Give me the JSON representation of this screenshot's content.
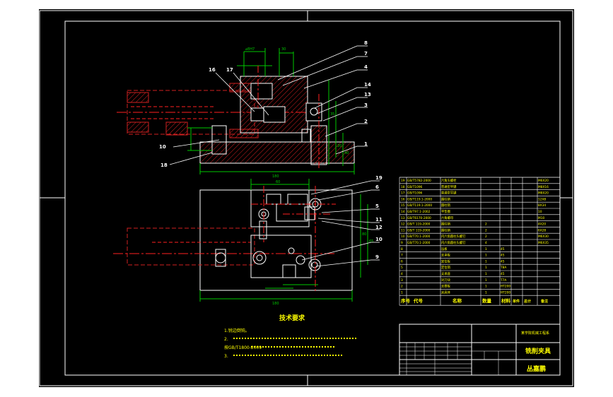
{
  "colors": {
    "background": "#000000",
    "frame": "#ffffff",
    "part_outline": "#ffffff",
    "dimension": "#00c800",
    "centerline": "#ff2020",
    "hatch": "#d02020",
    "leader": "#ffffff",
    "table_text": "#ffff00",
    "title_text": "#ffff00",
    "notes_text": "#ffff00",
    "part_number": "#ffffff"
  },
  "labels": {
    "callouts_top": [
      "8",
      "7",
      "4",
      "16",
      "17",
      "14",
      "13",
      "3",
      "2",
      "1",
      "10",
      "18"
    ],
    "callouts_bottom": [
      "19",
      "6",
      "5",
      "11",
      "12",
      "10",
      "9"
    ],
    "tech_title": "技术要求",
    "notes": [
      "1.锐边倒钝。",
      "2.",
      "按GB/T1800-2009",
      "3."
    ],
    "title_block": {
      "product_name": "铣削夹具",
      "drawer": "丛嘉鹏",
      "company": "某学院机械工程系"
    },
    "table_headers": [
      "序号",
      "代号",
      "名称",
      "数量",
      "材料",
      "单件",
      "总计",
      "备注"
    ]
  },
  "bom_rows": [
    {
      "no": "19",
      "code": "GB/T5782-2000",
      "name": "六角头螺栓",
      "qty": "",
      "mat": "",
      "remark": "M6X20"
    },
    {
      "no": "18",
      "code": "GB/T1096",
      "name": "普通型平键",
      "qty": "",
      "mat": "",
      "remark": "M8X16"
    },
    {
      "no": "17",
      "code": "GB/T1096",
      "name": "普通型平键",
      "qty": "",
      "mat": "",
      "remark": "M8X20"
    },
    {
      "no": "16",
      "code": "GB/T119.1-2000",
      "name": "圆柱销",
      "qty": "",
      "mat": "",
      "remark": "12X8"
    },
    {
      "no": "15",
      "code": "GB/T119.1-2000",
      "name": "圆柱销",
      "qty": "",
      "mat": "",
      "remark": "8X34"
    },
    {
      "no": "14",
      "code": "GB/T97.1-2002",
      "name": "平垫圈",
      "qty": "",
      "mat": "",
      "remark": "10"
    },
    {
      "no": "13",
      "code": "GB/T6170-2000",
      "name": "六角螺母",
      "qty": "",
      "mat": "",
      "remark": "M10"
    },
    {
      "no": "12",
      "code": "GB/T 119-2000",
      "name": "圆柱销",
      "qty": "2",
      "mat": "",
      "remark": "4X20"
    },
    {
      "no": "11",
      "code": "GB/T 119-2000",
      "name": "圆柱销",
      "qty": "2",
      "mat": "",
      "remark": "6X28"
    },
    {
      "no": "10",
      "code": "GB/T70.1-2000",
      "name": "内六角圆柱头螺钉",
      "qty": "2",
      "mat": "",
      "remark": "M6X30"
    },
    {
      "no": "9",
      "code": "GB/T70.1-2000",
      "name": "内六角圆柱头螺钉",
      "qty": "4",
      "mat": "",
      "remark": "M6X35"
    },
    {
      "no": "8",
      "code": "",
      "name": "压板",
      "qty": "1",
      "mat": "45",
      "remark": ""
    },
    {
      "no": "7",
      "code": "",
      "name": "支承板",
      "qty": "1",
      "mat": "45",
      "remark": ""
    },
    {
      "no": "6",
      "code": "",
      "name": "定位板",
      "qty": "1",
      "mat": "45",
      "remark": ""
    },
    {
      "no": "5",
      "code": "",
      "name": "定位销",
      "qty": "1",
      "mat": "T8A",
      "remark": ""
    },
    {
      "no": "4",
      "code": "",
      "name": "支承座",
      "qty": "1",
      "mat": "45",
      "remark": ""
    },
    {
      "no": "3",
      "code": "",
      "name": "对刀块",
      "qty": "1",
      "mat": "T7A",
      "remark": ""
    },
    {
      "no": "2",
      "code": "",
      "name": "支撑板",
      "qty": "1",
      "mat": "HT200",
      "remark": ""
    },
    {
      "no": "1",
      "code": "",
      "name": "夹具体",
      "qty": "1",
      "mat": "HT200",
      "remark": ""
    }
  ]
}
